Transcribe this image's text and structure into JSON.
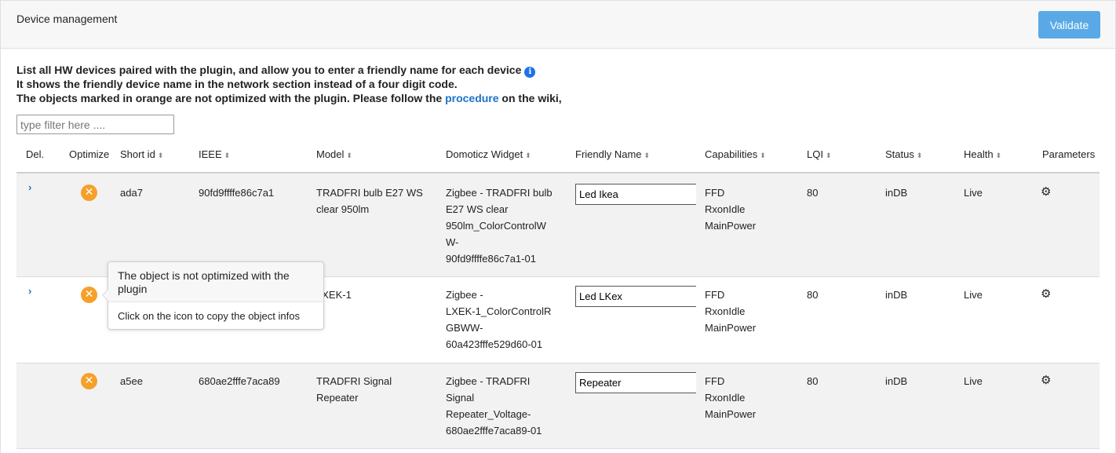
{
  "header": {
    "title": "Device management",
    "validate_label": "Validate"
  },
  "intro": {
    "line1": "List all HW devices paired with the plugin, and allow you to enter a friendly name for each device",
    "info_icon": "i",
    "line2": "It shows the friendly device name in the network section instead of a four digit code.",
    "line3_before": "The objects marked in orange are not optimized with the plugin. Please follow the ",
    "line3_link": "procedure",
    "line3_after": " on the wiki,"
  },
  "filter": {
    "placeholder": "type filter here ...."
  },
  "columns": {
    "del": "Del.",
    "optimize": "Optimize",
    "short_id": "Short id",
    "ieee": "IEEE",
    "model": "Model",
    "widget": "Domoticz Widget",
    "friendly": "Friendly Name",
    "capabilities": "Capabilities",
    "lqi": "LQI",
    "status": "Status",
    "health": "Health",
    "parameters": "Parameters"
  },
  "sort_icon": "⬍",
  "not_optimized_icon": "✕",
  "expand_icon": "›",
  "gear_icon": "⚙",
  "rows": [
    {
      "short_id": "ada7",
      "ieee": "90fd9ffffe86c7a1",
      "model_1": "TRADFRI bulb E27 WS",
      "model_2": "clear 950lm",
      "widget_1": "Zigbee - TRADFRI bulb",
      "widget_2": "E27 WS clear",
      "widget_3": "950lm_ColorControlW",
      "widget_4": "W-",
      "widget_5": "90fd9ffffe86c7a1-01",
      "friendly": "Led Ikea",
      "cap_1": "FFD",
      "cap_2": "RxonIdle",
      "cap_3": "MainPower",
      "lqi": "80",
      "status": "inDB",
      "health": "Live"
    },
    {
      "short_id": "",
      "ieee": "",
      "model_1": "LXEK-1",
      "widget_1": "Zigbee -",
      "widget_2": "LXEK-1_ColorControlR",
      "widget_3": "GBWW-",
      "widget_4": "60a423fffe529d60-01",
      "friendly": "Led LKex",
      "cap_1": "FFD",
      "cap_2": "RxonIdle",
      "cap_3": "MainPower",
      "lqi": "80",
      "status": "inDB",
      "health": "Live"
    },
    {
      "short_id": "a5ee",
      "ieee": "680ae2fffe7aca89",
      "model_1": "TRADFRI Signal",
      "model_2": "Repeater",
      "widget_1": "Zigbee - TRADFRI",
      "widget_2": "Signal",
      "widget_3": "Repeater_Voltage-",
      "widget_4": "680ae2fffe7aca89-01",
      "friendly": "Repeater",
      "cap_1": "FFD",
      "cap_2": "RxonIdle",
      "cap_3": "MainPower",
      "lqi": "80",
      "status": "inDB",
      "health": "Live"
    }
  ],
  "tooltip": {
    "title": "The object is not optimized with the plugin",
    "body": "Click on the icon to copy the object infos"
  },
  "colors": {
    "accent": "#5aa9e6",
    "warning": "#f6a02a",
    "link": "#1a73c8"
  }
}
